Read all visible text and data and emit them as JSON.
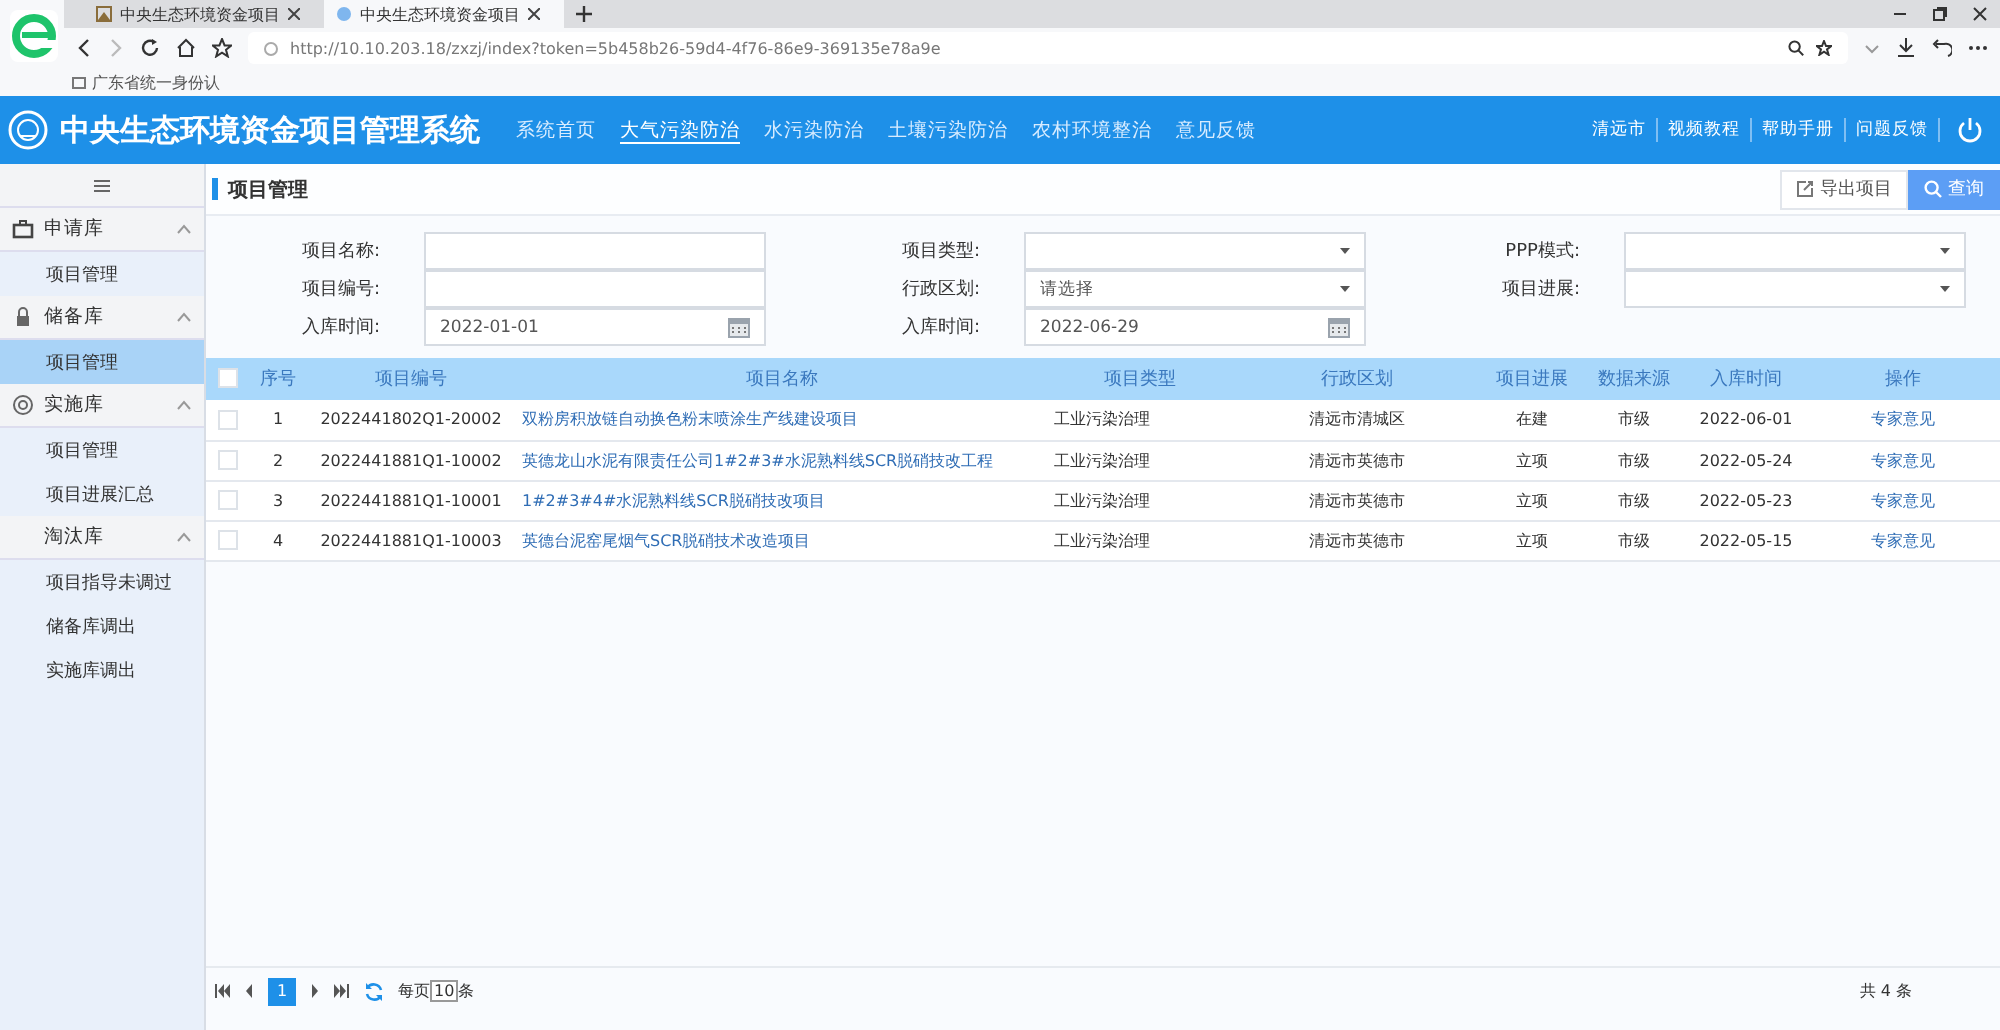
{
  "browser": {
    "tabs": [
      {
        "title": "中央生态环境资金项目",
        "selected": false
      },
      {
        "title": "中央生态环境资金项目",
        "selected": true
      }
    ],
    "url": "http://10.10.203.18/zxzj/index?token=5b458b26-59d4-4f76-86e9-369135e78a9e",
    "bookmarks": [
      "广东省统一身份认"
    ]
  },
  "header": {
    "title": "中央生态环境资金项目管理系统",
    "nav": [
      {
        "label": "系统首页",
        "selected": false
      },
      {
        "label": "大气污染防治",
        "selected": true
      },
      {
        "label": "水污染防治",
        "selected": false
      },
      {
        "label": "土壤污染防治",
        "selected": false
      },
      {
        "label": "农村环境整治",
        "selected": false
      },
      {
        "label": "意见反馈",
        "selected": false
      }
    ],
    "links": [
      "清远市",
      "视频教程",
      "帮助手册",
      "问题反馈"
    ]
  },
  "sidebar": {
    "groups": [
      {
        "label": "申请库",
        "expanded": true,
        "children": [
          {
            "label": "项目管理",
            "selected": false
          }
        ]
      },
      {
        "label": "储备库",
        "expanded": true,
        "children": [
          {
            "label": "项目管理",
            "selected": true
          }
        ]
      },
      {
        "label": "实施库",
        "expanded": true,
        "children": [
          {
            "label": "项目管理",
            "selected": false
          },
          {
            "label": "项目进展汇总",
            "selected": false
          }
        ]
      },
      {
        "label": "淘汰库",
        "expanded": true,
        "children": [
          {
            "label": "项目指导未调过",
            "selected": false
          },
          {
            "label": "储备库调出",
            "selected": false
          },
          {
            "label": "实施库调出",
            "selected": false
          }
        ]
      }
    ]
  },
  "page": {
    "title": "项目管理",
    "buttons": [
      {
        "label": "导出项目",
        "kind": "export"
      },
      {
        "label": "查询",
        "kind": "search"
      }
    ]
  },
  "filters": [
    {
      "label": "项目名称:",
      "kind": "text"
    },
    {
      "label": "项目类型:",
      "kind": "select"
    },
    {
      "label": "PPP模式:",
      "kind": "select"
    },
    {
      "label": "项目编号:",
      "kind": "text"
    },
    {
      "label": "行政区划:",
      "kind": "select",
      "value": "请选择"
    },
    {
      "label": "项目进展:",
      "kind": "select"
    },
    {
      "label": "入库时间:",
      "kind": "date",
      "value": "2022-01-01"
    },
    {
      "label": "入库时间:",
      "kind": "date",
      "value": "2022-06-29"
    }
  ],
  "table": {
    "all_checked": false,
    "columns": [
      "序号",
      "项目编号",
      "项目名称",
      "项目类型",
      "行政区划",
      "项目进展",
      "数据来源",
      "入库时间",
      "操作"
    ],
    "rows": [
      {
        "checked": false,
        "cells": [
          "1",
          "2022441802Q1-20002",
          "双粉房积放链自动换色粉末喷涂生产线建设项目",
          "工业污染治理",
          "清远市清城区",
          "在建",
          "市级",
          "2022-06-01",
          "专家意见"
        ]
      },
      {
        "checked": false,
        "cells": [
          "2",
          "2022441881Q1-10002",
          "英德龙山水泥有限责任公司1#2#3#水泥熟料线SCR脱硝技改工程",
          "工业污染治理",
          "清远市英德市",
          "立项",
          "市级",
          "2022-05-24",
          "专家意见"
        ]
      },
      {
        "checked": false,
        "cells": [
          "3",
          "2022441881Q1-10001",
          "1#2#3#4#水泥熟料线SCR脱硝技改项目",
          "工业污染治理",
          "清远市英德市",
          "立项",
          "市级",
          "2022-05-23",
          "专家意见"
        ]
      },
      {
        "checked": false,
        "cells": [
          "4",
          "2022441881Q1-10003",
          "英德台泥窑尾烟气SCR脱硝技术改造项目",
          "工业污染治理",
          "清远市英德市",
          "立项",
          "市级",
          "2022-05-15",
          "专家意见"
        ]
      }
    ]
  },
  "pager": {
    "page": "1",
    "per_page_label": "每页",
    "per_page": "10",
    "unit": "条",
    "total": "共 4 条"
  }
}
